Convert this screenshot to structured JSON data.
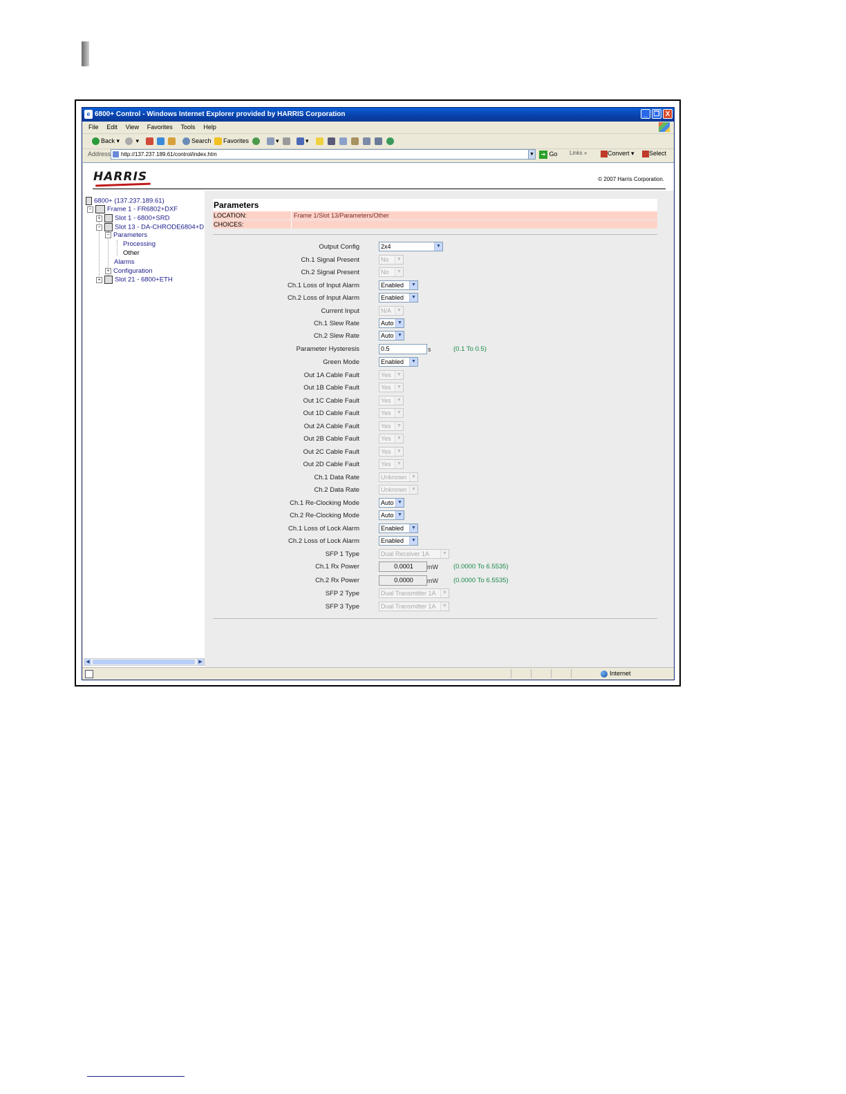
{
  "browser": {
    "title": "6800+ Control - Windows Internet Explorer provided by HARRIS Corporation",
    "window_buttons": [
      "_",
      "❐",
      "X"
    ],
    "menu": [
      "File",
      "Edit",
      "View",
      "Favorites",
      "Tools",
      "Help"
    ],
    "toolbar": {
      "back": "Back",
      "search": "Search",
      "favorites": "Favorites"
    },
    "address_label": "Address",
    "address_value": "http://137.237.189.61/control/index.htm",
    "go": "Go",
    "links": "Links",
    "links_chevron": "»",
    "convert": "Convert",
    "select": "Select",
    "status_zone": "Internet"
  },
  "header": {
    "logo": "HARRIS",
    "copyright": "© 2007 Harris Corporation."
  },
  "tree": [
    {
      "label": "6800+ (137.237.189.61)"
    },
    {
      "label": "Frame 1 - FR6802+DXF",
      "pm": "−"
    },
    {
      "label": "Slot 1 - 6800+SRD",
      "pm": "+"
    },
    {
      "label": "Slot 13 - DA-CHRODE6804+D",
      "pm": "−"
    },
    {
      "label": "Parameters",
      "pm": "−"
    },
    {
      "label": "Processing"
    },
    {
      "label": "Other"
    },
    {
      "label": "Alarms"
    },
    {
      "label": "Configuration",
      "pm": "+"
    },
    {
      "label": "Slot 21 - 6800+ETH",
      "pm": "+"
    }
  ],
  "panel": {
    "title": "Parameters",
    "location_label": "LOCATION:",
    "location_value": "Frame 1/Slot 13/Parameters/Other",
    "choices_label": "CHOICES:",
    "choices_value": ""
  },
  "params": [
    {
      "label": "Output Config",
      "value": "2x4",
      "enabled": true
    },
    {
      "label": "Ch.1 Signal Present",
      "value": "No",
      "enabled": false
    },
    {
      "label": "Ch.2 Signal Present",
      "value": "No",
      "enabled": false
    },
    {
      "label": "Ch.1 Loss of Input Alarm",
      "value": "Enabled",
      "enabled": true
    },
    {
      "label": "Ch.2 Loss of Input Alarm",
      "value": "Enabled",
      "enabled": true
    },
    {
      "label": "Current Input",
      "value": "N/A",
      "enabled": false
    },
    {
      "label": "Ch.1 Slew Rate",
      "value": "Auto",
      "enabled": true
    },
    {
      "label": "Ch.2 Slew Rate",
      "value": "Auto",
      "enabled": true
    },
    {
      "label": "Parameter Hysteresis",
      "value": "0.5",
      "unit": "s",
      "range": "(0.1 To 0.5)",
      "enabled": true
    },
    {
      "label": "Green Mode",
      "value": "Enabled",
      "enabled": true
    },
    {
      "label": "Out 1A Cable Fault",
      "value": "Yes",
      "enabled": false
    },
    {
      "label": "Out 1B Cable Fault",
      "value": "Yes",
      "enabled": false
    },
    {
      "label": "Out 1C Cable Fault",
      "value": "Yes",
      "enabled": false
    },
    {
      "label": "Out 1D Cable Fault",
      "value": "Yes",
      "enabled": false
    },
    {
      "label": "Out 2A Cable Fault",
      "value": "Yes",
      "enabled": false
    },
    {
      "label": "Out 2B Cable Fault",
      "value": "Yes",
      "enabled": false
    },
    {
      "label": "Out 2C Cable Fault",
      "value": "Yes",
      "enabled": false
    },
    {
      "label": "Out 2D Cable Fault",
      "value": "Yes",
      "enabled": false
    },
    {
      "label": "Ch.1 Data Rate",
      "value": "Unknown",
      "enabled": false
    },
    {
      "label": "Ch.2 Data Rate",
      "value": "Unknown",
      "enabled": false
    },
    {
      "label": "Ch.1 Re-Clocking Mode",
      "value": "Auto",
      "enabled": true
    },
    {
      "label": "Ch.2 Re-Clocking Mode",
      "value": "Auto",
      "enabled": true
    },
    {
      "label": "Ch.1 Loss of Lock Alarm",
      "value": "Enabled",
      "enabled": true
    },
    {
      "label": "Ch.2 Loss of Lock Alarm",
      "value": "Enabled",
      "enabled": true
    },
    {
      "label": "SFP 1 Type",
      "value": "Dual Receiver 1A",
      "enabled": false
    },
    {
      "label": "Ch.1 Rx Power",
      "value": "0.0001",
      "unit": "mW",
      "range": "(0.0000 To 6.5535)",
      "enabled": false
    },
    {
      "label": "Ch.2 Rx Power",
      "value": "0.0000",
      "unit": "mW",
      "range": "(0.0000 To 6.5535)",
      "enabled": false
    },
    {
      "label": "SFP 2 Type",
      "value": "Dual Transmitter 1A",
      "enabled": false
    },
    {
      "label": "SFP 3 Type",
      "value": "Dual Transmitter 1A",
      "enabled": false
    }
  ]
}
